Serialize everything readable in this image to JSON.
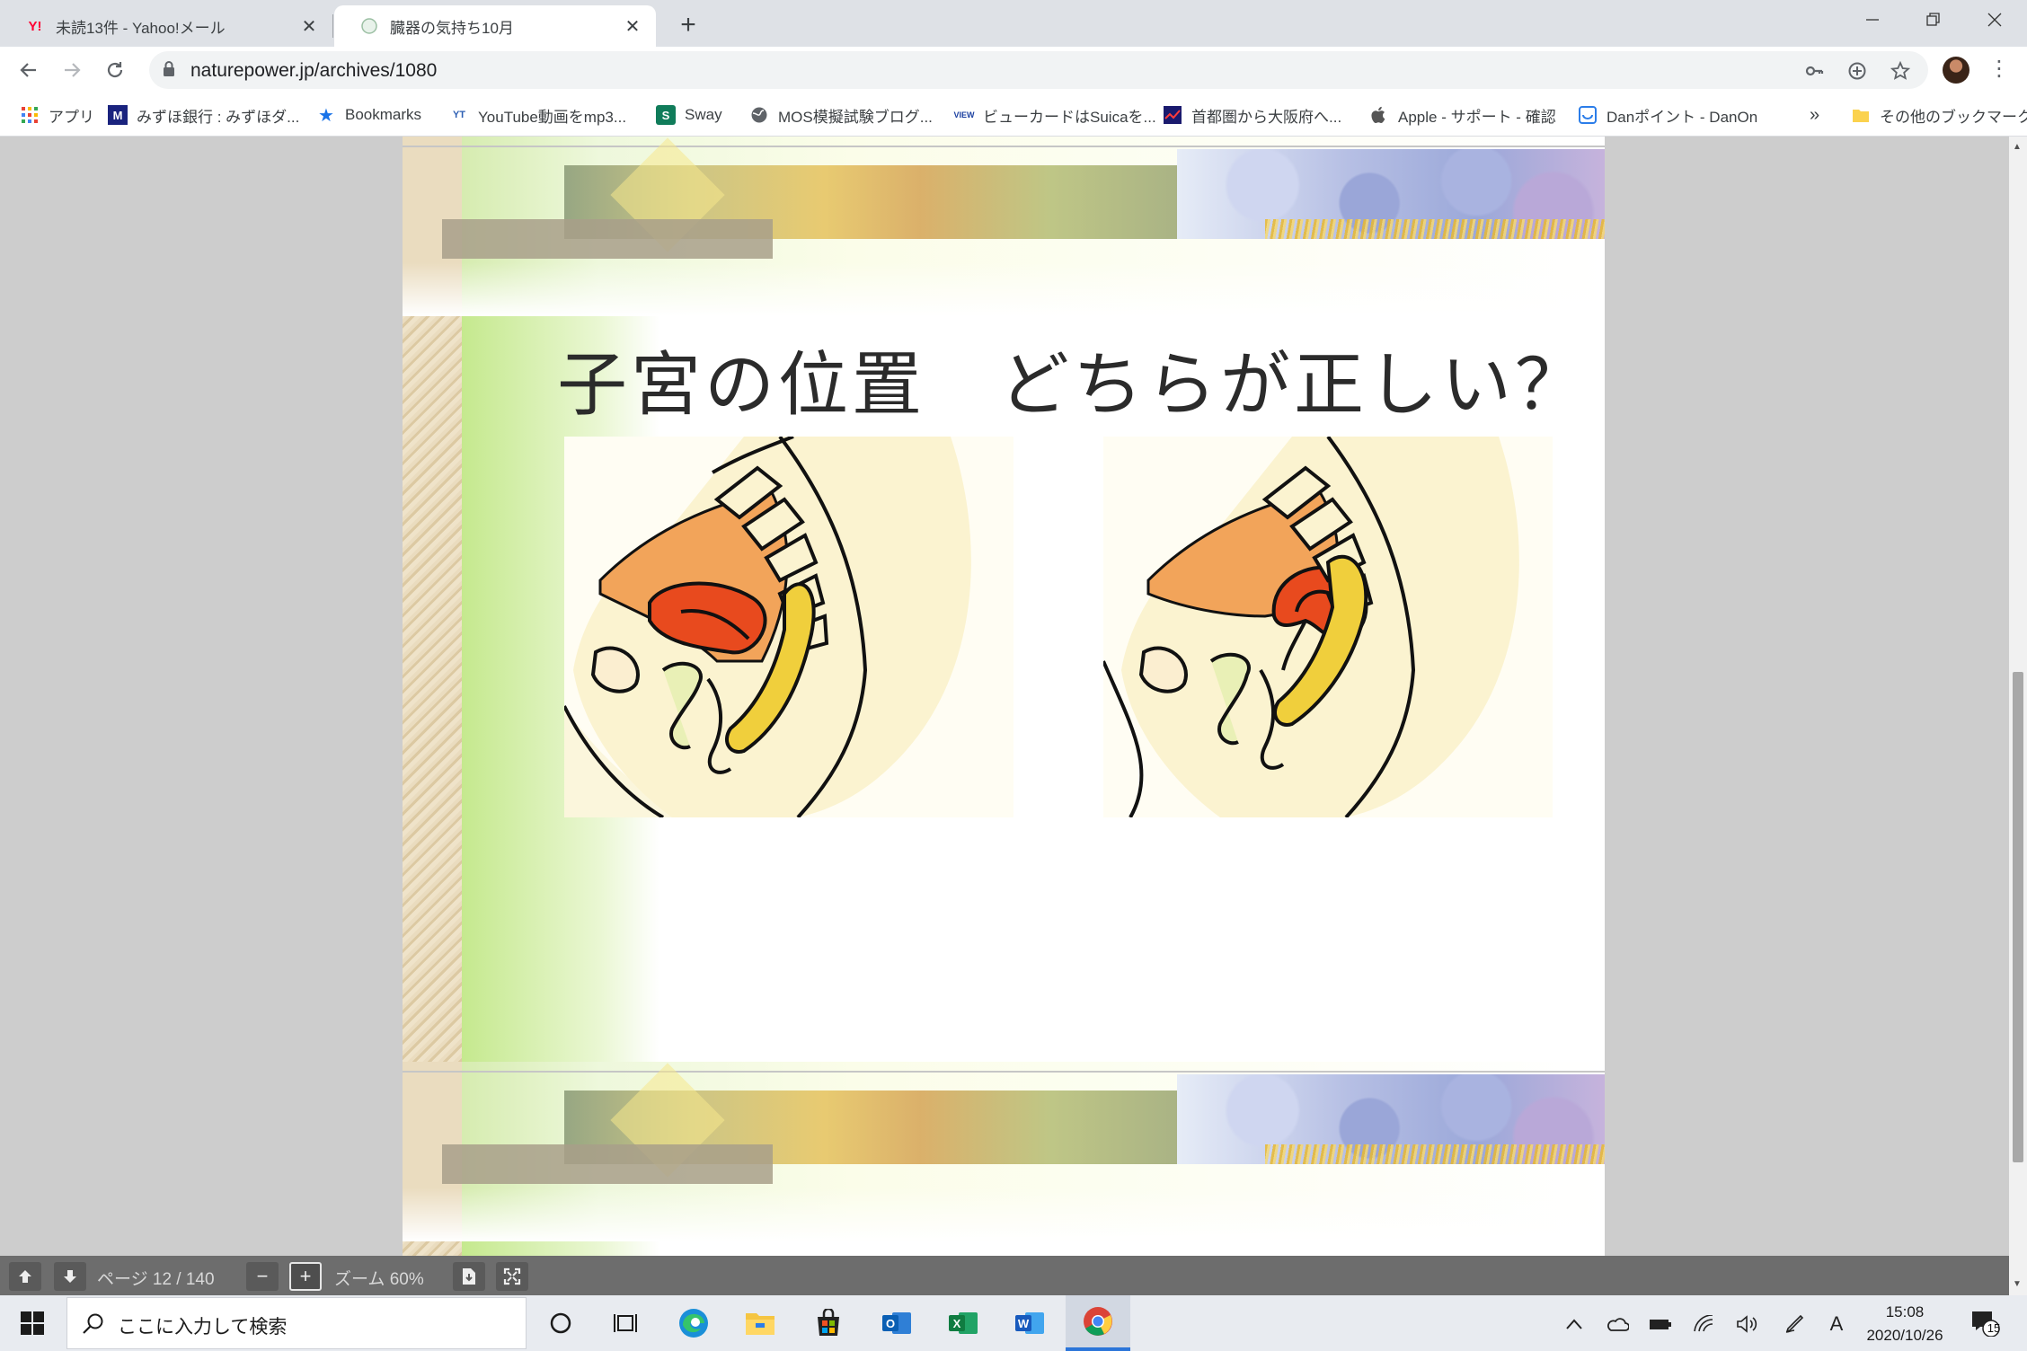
{
  "tabs": [
    {
      "title": "未読13件 - Yahoo!メール",
      "favicon": "Y!"
    },
    {
      "title": "臓器の気持ち10月",
      "active": true
    }
  ],
  "toolbar": {
    "url": "naturepower.jp/archives/1080"
  },
  "bookmarks": [
    {
      "label": "アプリ",
      "icon": "apps-grid-icon"
    },
    {
      "label": "みずほ銀行 : みずほダ...",
      "icon": "M"
    },
    {
      "label": "Bookmarks",
      "icon": "star-icon"
    },
    {
      "label": "YouTube動画をmp3...",
      "icon": "mp3-icon"
    },
    {
      "label": "Sway",
      "icon": "S"
    },
    {
      "label": "MOS模擬試験ブログ...",
      "icon": "globe-icon"
    },
    {
      "label": "ビューカードはSuicaを...",
      "icon": "VIEW"
    },
    {
      "label": "首都圏から大阪府へ...",
      "icon": "chart-icon"
    },
    {
      "label": "Apple - サポート - 確認",
      "icon": "apple-icon"
    },
    {
      "label": "Danポイント - DanOn",
      "icon": "danon-icon"
    }
  ],
  "bookmarks_overflow": "»",
  "other_bookmarks": "その他のブックマーク",
  "slide": {
    "title": "子宮の位置　どちらが正しい？"
  },
  "pdf_controls": {
    "page_label": "ページ 12 / 140",
    "zoom_label": "ズーム 60%",
    "zoom_out": "−",
    "zoom_in": "+"
  },
  "taskbar": {
    "search_placeholder": "ここに入力して検索",
    "ime": "A",
    "time": "15:08",
    "date": "2020/10/26",
    "notifications": "15"
  },
  "colors": {
    "chrome_accent": "#1a73e8",
    "uterus": "#e84a1e",
    "bladder_fill": "#f0a060",
    "rectum": "#f0cf3c",
    "skin": "#fbf3d0"
  }
}
